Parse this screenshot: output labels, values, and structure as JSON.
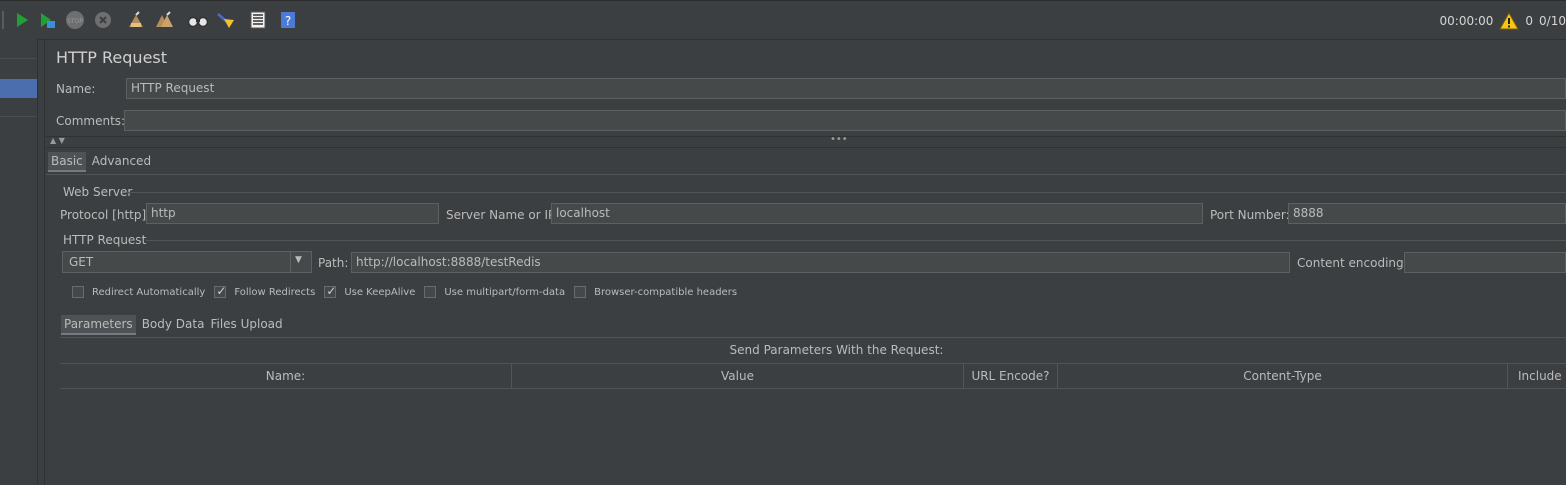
{
  "toolbar": {
    "icons": [
      "start-icon",
      "start-no-pauses-icon",
      "stop-icon",
      "shutdown-icon",
      "clear-icon",
      "clear-all-icon",
      "search-icon",
      "reset-search-icon",
      "function-helper-icon",
      "help-icon"
    ],
    "timer": "00:00:00",
    "warning_count": "0",
    "threads": "0/10"
  },
  "panel": {
    "title": "HTTP Request",
    "name_label": "Name:",
    "name_value": "HTTP Request",
    "comments_label": "Comments:",
    "comments_value": ""
  },
  "tabs": [
    "Basic",
    "Advanced"
  ],
  "web_server": {
    "group_title": "Web Server",
    "protocol_label": "Protocol [http]:",
    "protocol_value": "http",
    "server_label": "Server Name or IP:",
    "server_value": "localhost",
    "port_label": "Port Number:",
    "port_value": "8888"
  },
  "http_request": {
    "group_title": "HTTP Request",
    "method": "GET",
    "path_label": "Path:",
    "path_value": "http://localhost:8888/testRedis",
    "encoding_label": "Content encoding:",
    "encoding_value": ""
  },
  "options": [
    {
      "label": "Redirect Automatically",
      "checked": false
    },
    {
      "label": "Follow Redirects",
      "checked": true
    },
    {
      "label": "Use KeepAlive",
      "checked": true
    },
    {
      "label": "Use multipart/form-data",
      "checked": false
    },
    {
      "label": "Browser-compatible headers",
      "checked": false
    }
  ],
  "param_tabs": [
    "Parameters",
    "Body Data",
    "Files Upload"
  ],
  "params_table": {
    "caption": "Send Parameters With the Request:",
    "columns": [
      "Name:",
      "Value",
      "URL Encode?",
      "Content-Type",
      "Include Equals?"
    ]
  }
}
